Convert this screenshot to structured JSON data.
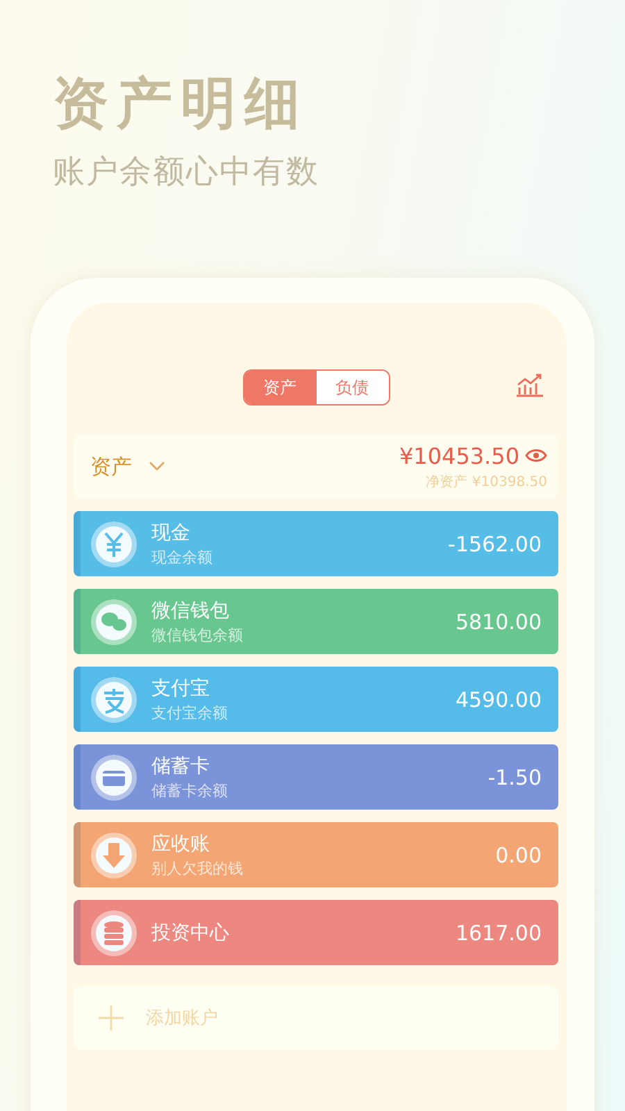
{
  "headline": {
    "title": "资产明细",
    "subtitle": "账户余额心中有数"
  },
  "tabs": [
    {
      "label": "资产",
      "selected": true
    },
    {
      "label": "负债",
      "selected": false
    }
  ],
  "summary": {
    "label": "资产",
    "total": "¥10453.50",
    "net": "净资产 ¥10398.50"
  },
  "accounts": [
    {
      "kind": "cash",
      "name": "现金",
      "note": "现金余额",
      "amount": "-1562.00",
      "color": "#56bde6"
    },
    {
      "kind": "wechat",
      "name": "微信钱包",
      "note": "微信钱包余额",
      "amount": "5810.00",
      "color": "#67c78f"
    },
    {
      "kind": "alipay",
      "name": "支付宝",
      "note": "支付宝余额",
      "amount": "4590.00",
      "color": "#55bbe8"
    },
    {
      "kind": "card",
      "name": "储蓄卡",
      "note": "储蓄卡余额",
      "amount": "-1.50",
      "color": "#7b93d8"
    },
    {
      "kind": "receivable",
      "name": "应收账",
      "note": "别人欠我的钱",
      "amount": "0.00",
      "color": "#f3a673"
    },
    {
      "kind": "invest",
      "name": "投资中心",
      "amount": "1617.00",
      "color": "#ec8880"
    }
  ],
  "add_account": {
    "label": "添加账户"
  }
}
